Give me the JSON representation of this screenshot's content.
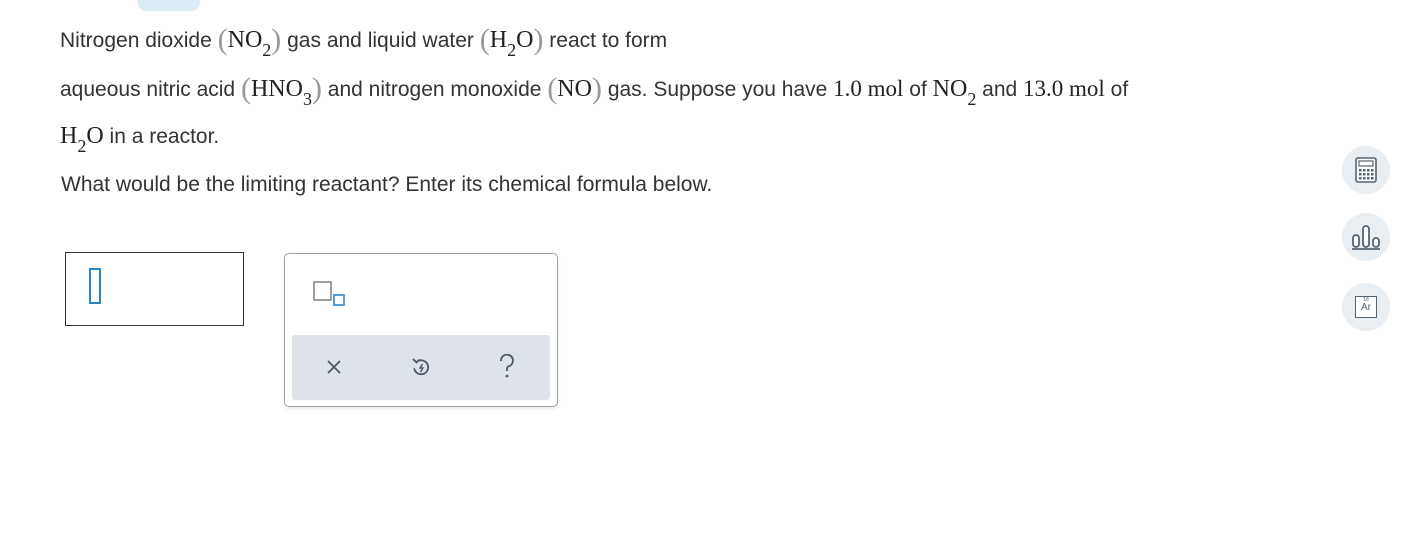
{
  "problem": {
    "line1": {
      "t1": "Nitrogen dioxide",
      "f1": {
        "main": "NO",
        "sub": "2"
      },
      "t2": "gas and liquid water",
      "f2": {
        "pre": "H",
        "sub": "2",
        "post": "O"
      },
      "t3": "react to form"
    },
    "line2": {
      "t1": "aqueous nitric acid",
      "f1": {
        "main": "HNO",
        "sub": "3"
      },
      "t2": "and nitrogen monoxide",
      "f2": "NO",
      "t3": "gas. Suppose you have",
      "q1": "1.0 mol",
      "t4": "of",
      "f3": {
        "main": "NO",
        "sub": "2"
      },
      "t5": "and",
      "q2": "13.0 mol",
      "t6": "of"
    },
    "line3": {
      "f1": {
        "pre": "H",
        "sub": "2",
        "post": "O"
      },
      "t1": "in a reactor."
    }
  },
  "question": "What would be the limiting reactant? Enter its chemical formula below.",
  "answer": {
    "value": ""
  },
  "palette": {
    "tools": [
      "subscript-icon",
      "clear-icon",
      "undo-icon",
      "help-icon"
    ],
    "help_symbol": "?",
    "clear_symbol": "×"
  },
  "side_tools": {
    "items": [
      "calculator-icon",
      "bar-chart-icon",
      "periodic-table-icon"
    ],
    "periodic": {
      "number": "18",
      "symbol": "Ar"
    }
  },
  "colors": {
    "accent": "#2a87c8",
    "toolbar_bg": "#dde3e8",
    "side_button_bg": "#e9eef2",
    "top_tab": "#dcecf6"
  }
}
